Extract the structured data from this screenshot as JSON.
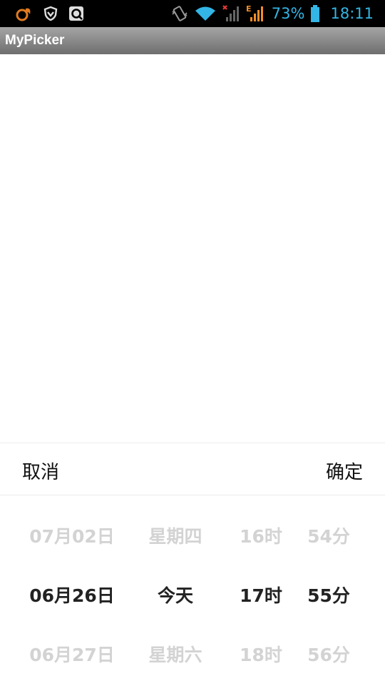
{
  "status_bar": {
    "icons": [
      "uc-browser-icon",
      "shield-icon",
      "sync-icon",
      "vibrate-icon",
      "wifi-icon",
      "no-signal-icon",
      "signal-e-icon",
      "battery-icon"
    ],
    "battery_percent": "73%",
    "time": "18:11",
    "accent_color": "#33b5e5"
  },
  "title_bar": {
    "title": "MyPicker"
  },
  "picker": {
    "cancel_label": "取消",
    "confirm_label": "确定",
    "date_column": {
      "prev": "07月02日",
      "selected": "06月26日",
      "next": "06月27日"
    },
    "weekday_column": {
      "prev": "星期四",
      "selected": "今天",
      "next": "星期六"
    },
    "hour_column": {
      "prev": "16时",
      "selected": "17时",
      "next": "18时"
    },
    "minute_column": {
      "prev": "54分",
      "selected": "55分",
      "next": "56分"
    }
  }
}
